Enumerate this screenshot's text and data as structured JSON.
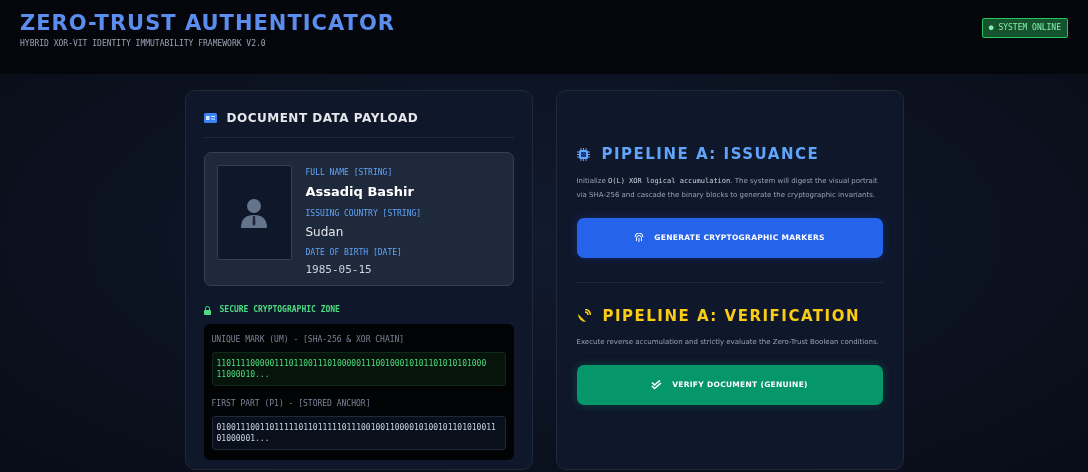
{
  "header": {
    "title": "ZERO-TRUST AUTHENTICATOR",
    "subtitle": "HYBRID XOR-VIT IDENTITY IMMUTABILITY FRAMEWORK V2.0",
    "status": {
      "label": "● SYSTEM ONLINE",
      "online": true
    }
  },
  "document_panel": {
    "title": "DOCUMENT DATA PAYLOAD",
    "fields": [
      {
        "label": "FULL NAME [STRING]",
        "value": "Assadiq Bashir",
        "kind": "name"
      },
      {
        "label": "ISSUING COUNTRY [STRING]",
        "value": "Sudan",
        "kind": "text"
      },
      {
        "label": "DATE OF BIRTH [DATE]",
        "value": "1985-05-15",
        "kind": "mono"
      }
    ],
    "secure_zone": {
      "title": "SECURE CRYPTOGRAPHIC ZONE",
      "entries": [
        {
          "label": "UNIQUE MARK (UM) - [SHA-256 & XOR CHAIN]",
          "lines": [
            "11011110000011101100111010000011100100010101101010101000",
            "11000010..."
          ],
          "kind": "mark"
        },
        {
          "label": "FIRST PART (P1) - [STORED ANCHOR]",
          "lines": [
            "0100111001101111101101111101110010011000010100101101010011",
            "01000001..."
          ],
          "kind": "anchor"
        }
      ]
    }
  },
  "pipelines": [
    {
      "title": "PIPELINE A: ISSUANCE",
      "kind": "issuance",
      "description": {
        "before": "Initialize ",
        "code": "O(L) XOR logical accumulation",
        "after": ". The system will digest the visual portrait via SHA-256 and cascade the binary blocks to generate the cryptographic invariants."
      },
      "button": "GENERATE CRYPTOGRAPHIC MARKERS"
    },
    {
      "title": "PIPELINE A: VERIFICATION",
      "kind": "verification",
      "description": {
        "before": "Execute reverse accumulation and strictly evaluate the Zero-Trust Boolean conditions."
      },
      "button": "VERIFY DOCUMENT (GENUINE)"
    }
  ]
}
